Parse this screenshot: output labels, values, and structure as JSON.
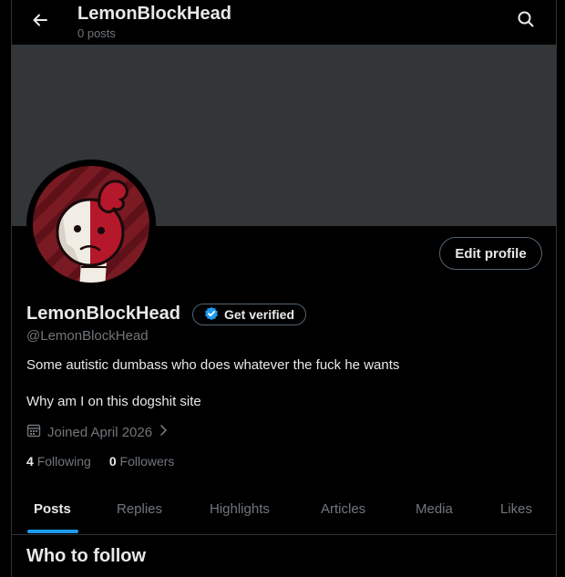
{
  "header": {
    "title": "LemonBlockHead",
    "subtitle": "0 posts",
    "back_icon": "arrow-left-icon",
    "search_icon": "search-icon"
  },
  "profile": {
    "display_name": "LemonBlockHead",
    "handle": "@LemonBlockHead",
    "verify_label": "Get verified",
    "edit_label": "Edit profile",
    "bio_line1": "Some autistic dumbass who does whatever the fuck he wants",
    "bio_line2": "Why am I on this dogshit site",
    "joined": "Joined April 2026",
    "following_count": "4",
    "following_label": "Following",
    "followers_count": "0",
    "followers_label": "Followers"
  },
  "tabs": [
    {
      "label": "Posts",
      "active": true
    },
    {
      "label": "Replies"
    },
    {
      "label": "Highlights"
    },
    {
      "label": "Articles"
    },
    {
      "label": "Media"
    },
    {
      "label": "Likes"
    }
  ],
  "who_to_follow": "Who to follow",
  "colors": {
    "background": "#000000",
    "banner": "#333639",
    "accent": "#1d9bf0",
    "muted_text": "#71767b",
    "avatar_red": "#b5182b"
  }
}
